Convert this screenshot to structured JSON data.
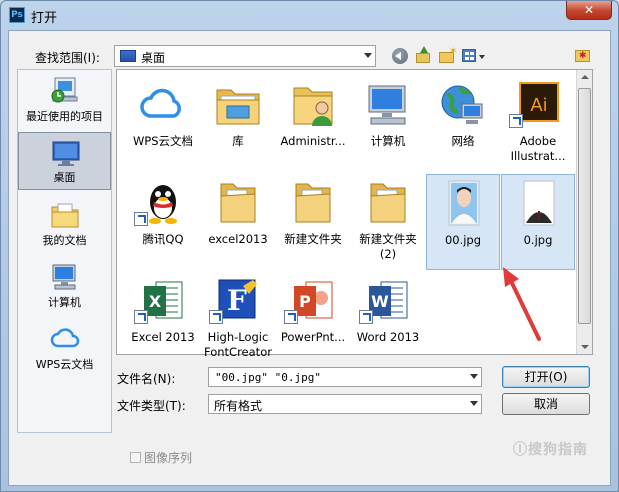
{
  "window": {
    "title": "打开",
    "app_icon": "Ps",
    "close_label": "✕"
  },
  "toolbar": {
    "look_in_label": "查找范围(I):",
    "look_in_value": "桌面",
    "icons": [
      "back-icon",
      "up-folder-icon",
      "new-folder-icon",
      "view-menu-icon",
      "favorite-folder-icon"
    ]
  },
  "places": [
    {
      "label": "最近使用的项目",
      "icon": "recent-items-icon"
    },
    {
      "label": "桌面",
      "icon": "desktop-icon",
      "selected": true
    },
    {
      "label": "我的文档",
      "icon": "documents-icon"
    },
    {
      "label": "计算机",
      "icon": "computer-icon"
    },
    {
      "label": "WPS云文档",
      "icon": "wps-cloud-icon"
    }
  ],
  "files": [
    {
      "line1": "WPS云文档",
      "line2": "",
      "icon": "wps-cloud-icon"
    },
    {
      "line1": "库",
      "line2": "",
      "icon": "library-icon"
    },
    {
      "line1": "Administr...",
      "line2": "",
      "icon": "user-folder-icon"
    },
    {
      "line1": "计算机",
      "line2": "",
      "icon": "computer-icon"
    },
    {
      "line1": "网络",
      "line2": "",
      "icon": "network-icon"
    },
    {
      "line1": "Adobe",
      "line2": "Illustrat...",
      "icon": "illustrator-icon"
    },
    {
      "line1": "腾讯QQ",
      "line2": "",
      "icon": "qq-icon"
    },
    {
      "line1": "excel2013",
      "line2": "",
      "icon": "folder-icon"
    },
    {
      "line1": "新建文件夹",
      "line2": "",
      "icon": "folder-icon"
    },
    {
      "line1": "新建文件夹",
      "line2": "(2)",
      "icon": "folder-icon"
    },
    {
      "line1": "00.jpg",
      "line2": "",
      "icon": "photo-thumbnail-icon",
      "selected": true
    },
    {
      "line1": "0.jpg",
      "line2": "",
      "icon": "suit-thumbnail-icon",
      "selected": true
    },
    {
      "line1": "Excel 2013",
      "line2": "",
      "icon": "excel-icon"
    },
    {
      "line1": "High-Logic",
      "line2": "FontCreator",
      "icon": "fontcreator-icon"
    },
    {
      "line1": "PowerPnt...",
      "line2": "",
      "icon": "powerpoint-icon"
    },
    {
      "line1": "Word 2013",
      "line2": "",
      "icon": "word-icon"
    }
  ],
  "form": {
    "filename_label": "文件名(N):",
    "filename_value": "\"00.jpg\" \"0.jpg\"",
    "filetype_label": "文件类型(T):",
    "filetype_value": "所有格式",
    "open_label": "打开(O)",
    "cancel_label": "取消",
    "image_sequence_label": "图像序列"
  },
  "watermark": "Ⓘ搜狗指南",
  "colors": {
    "selection": "#d6e6f7",
    "arrow": "#e03a3a",
    "titlebar": "#b6cde6"
  }
}
